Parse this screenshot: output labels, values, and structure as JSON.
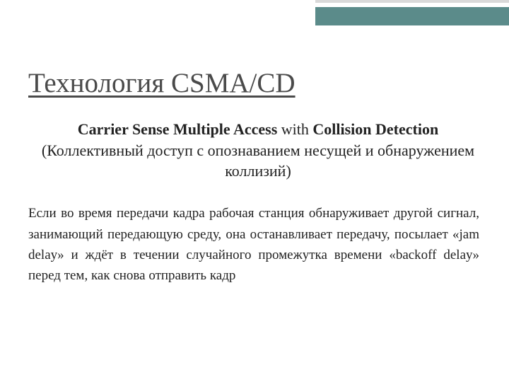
{
  "title": "Технология CSMA/CD",
  "subtitle": {
    "bold1": "Carrier Sense Multiple Access",
    "plain1": " with ",
    "bold2": "Collision Detection",
    "line2": "(Коллективный доступ с опознаванием несущей и обнаружением коллизий)"
  },
  "body": "Если во время передачи кадра рабочая станция обнаруживает другой сигнал, занимающий передающую среду, она останавливает передачу, посылает «jam delay» и ждёт в течении случайного промежутка времени «backoff delay» перед тем, как снова отправить кадр"
}
